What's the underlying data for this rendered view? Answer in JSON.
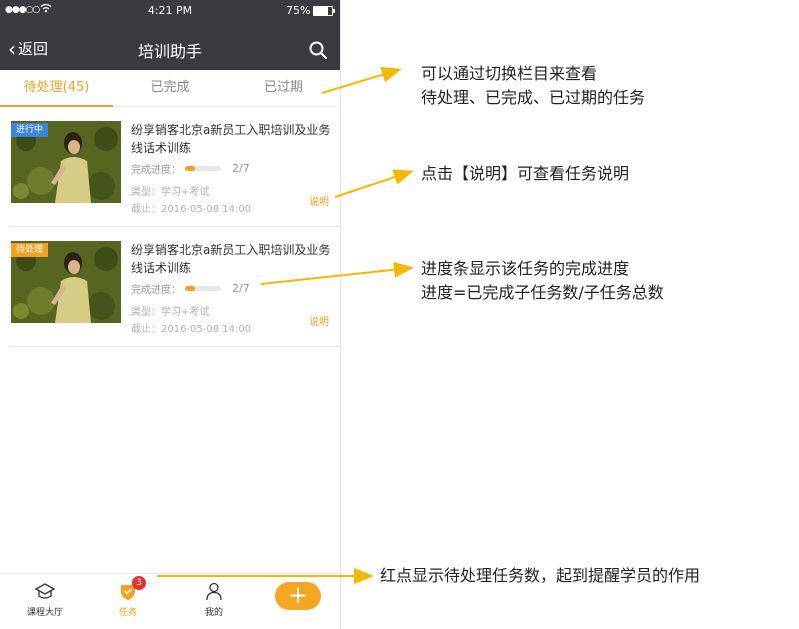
{
  "status_bar": {
    "signal": "●●●○○",
    "wifi": "wifi-icon",
    "time": "4:21 PM",
    "battery": "75%"
  },
  "nav": {
    "back_label": "返回",
    "title": "培训助手",
    "search_icon": "search-icon"
  },
  "tabs": [
    {
      "label": "待处理(45)",
      "active": true
    },
    {
      "label": "已完成",
      "active": false
    },
    {
      "label": "已过期",
      "active": false
    }
  ],
  "tasks": [
    {
      "badge": "进行中",
      "badge_color": "#3d85d8",
      "title": "纷享销客北京a新员工入职培训及业务线话术训练",
      "progress_label": "完成进度：",
      "progress": "2/7",
      "progress_fraction": 0.2857,
      "type": "类型：学习+考试",
      "deadline": "截止：2016-05-08 14:00",
      "explain": "说明"
    },
    {
      "badge": "待处理",
      "badge_color": "#f3a125",
      "title": "纷享销客北京a新员工入职培训及业务线话术训练",
      "progress_label": "完成进度：",
      "progress": "2/7",
      "progress_fraction": 0.2857,
      "type": "类型：学习+考试",
      "deadline": "截止：2016-05-08 14:00",
      "explain": "说明"
    }
  ],
  "tabbar": {
    "items": [
      {
        "label": "课程大厅",
        "icon": "graduation-cap-icon"
      },
      {
        "label": "任务",
        "icon": "task-shield-icon",
        "badge": "3"
      },
      {
        "label": "我的",
        "icon": "user-icon"
      }
    ],
    "add_label": "+"
  },
  "annotations": {
    "tabs_line1": "可以通过切换栏目来查看",
    "tabs_line2": "待处理、已完成、已过期的任务",
    "explain": "点击【说明】可查看任务说明",
    "progress_line1": "进度条显示该任务的完成进度",
    "progress_line2": "进度=已完成子任务数/子任务总数",
    "red_dot": "红点显示待处理任务数，起到提醒学员的作用"
  },
  "colors": {
    "accent": "#f3a125",
    "header_bg": "#3b3a40",
    "badge_red": "#e6322e",
    "arrow": "#f5b800"
  }
}
